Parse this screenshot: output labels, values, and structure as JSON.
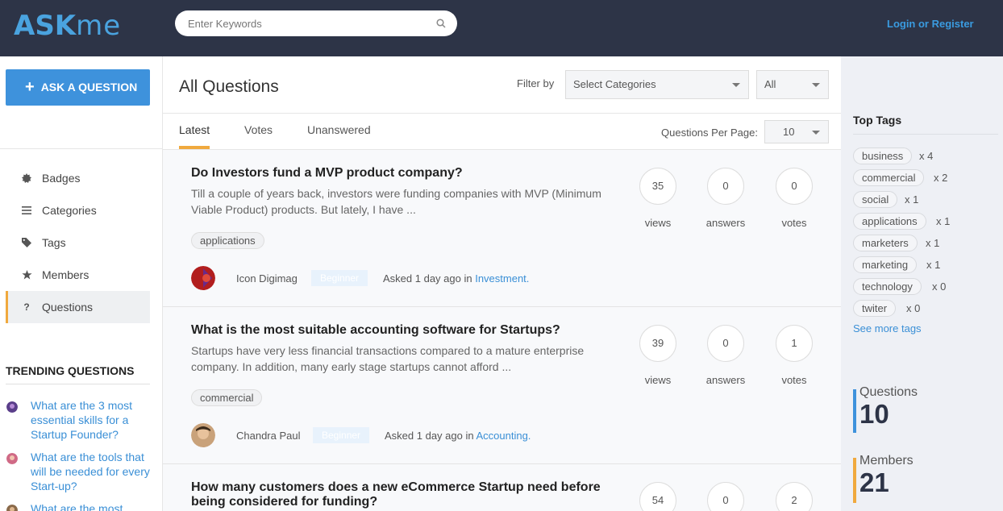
{
  "header": {
    "logo_bold": "ASK",
    "logo_light": "me",
    "search_placeholder": "Enter Keywords",
    "login_label": "Login or Register"
  },
  "sidebar": {
    "ask_button": "ASK A QUESTION",
    "nav": [
      {
        "label": "Badges",
        "icon": "badge-icon"
      },
      {
        "label": "Categories",
        "icon": "list-icon"
      },
      {
        "label": "Tags",
        "icon": "tag-icon"
      },
      {
        "label": "Members",
        "icon": "star-icon"
      },
      {
        "label": "Questions",
        "icon": "question-icon",
        "active": true
      }
    ],
    "trending_title": "TRENDING QUESTIONS",
    "trending": [
      "What are the 3 most essential skills for a Startup Founder?",
      "What are the tools that will be needed for every Start-up?",
      "What are the most"
    ]
  },
  "main": {
    "title": "All Questions",
    "filter_label": "Filter by",
    "category_select": "Select Categories",
    "scope_select": "All",
    "tabs": [
      "Latest",
      "Votes",
      "Unanswered"
    ],
    "per_page_label": "Questions Per Page:",
    "per_page_value": "10",
    "questions": [
      {
        "title": "Do Investors fund a MVP product company?",
        "excerpt": "Till a couple of years back, investors were funding companies with MVP (Minimum Viable Product) products. But lately, I have ...",
        "tag": "applications",
        "views": "35",
        "answers": "0",
        "votes": "0",
        "views_label": "views",
        "answers_label": "answers",
        "votes_label": "votes",
        "user": "Icon Digimag",
        "badge": "Beginner",
        "asked": "Asked 1 day ago in ",
        "category": "Investment."
      },
      {
        "title": "What is the most suitable accounting software for Startups?",
        "excerpt": "Startups have very less financial transactions compared to a mature enterprise company. In addition, many early stage startups cannot afford ...",
        "tag": "commercial",
        "views": "39",
        "answers": "0",
        "votes": "1",
        "views_label": "views",
        "answers_label": "answers",
        "votes_label": "votes",
        "user": "Chandra Paul",
        "badge": "Beginner",
        "asked": "Asked 1 day ago in ",
        "category": "Accounting."
      },
      {
        "title": "How many customers does a new eCommerce Startup need before being considered for funding?",
        "views": "54",
        "answers": "0",
        "votes": "2"
      }
    ]
  },
  "right": {
    "top_tags_title": "Top Tags",
    "tags": [
      {
        "name": "business",
        "count": "x 4"
      },
      {
        "name": "commercial",
        "count": "x 2"
      },
      {
        "name": "social",
        "count": "x 1"
      },
      {
        "name": "applications",
        "count": "x 1"
      },
      {
        "name": "marketers",
        "count": "x 1"
      },
      {
        "name": "marketing",
        "count": "x 1"
      },
      {
        "name": "technology",
        "count": "x 0"
      },
      {
        "name": "twiter",
        "count": "x 0"
      }
    ],
    "see_more": "See more tags",
    "stats": [
      {
        "label": "Questions",
        "value": "10",
        "color": "#3e92dc"
      },
      {
        "label": "Members",
        "value": "21",
        "color": "#f0a93e"
      }
    ]
  },
  "colors": {
    "header_bg": "#2d3447",
    "accent_blue": "#3e92dc",
    "accent_orange": "#f0a93e",
    "link": "#3a8fd6"
  }
}
